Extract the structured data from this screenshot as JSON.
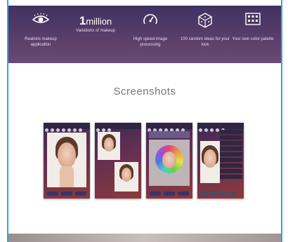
{
  "features": [
    {
      "icon": "eye-icon",
      "caption": "Realistic makeup application"
    },
    {
      "big_number": "1",
      "big_unit": "million",
      "caption": "Variations of makeup"
    },
    {
      "icon": "speedometer-icon",
      "caption": "High speed image processing"
    },
    {
      "icon": "dice-icon",
      "caption": "100 random ideas for your look"
    },
    {
      "icon": "palette-grid-icon",
      "caption": "Your own color palette"
    }
  ],
  "section_title": "Screenshots",
  "screenshots": [
    {
      "name": "screenshot-1"
    },
    {
      "name": "screenshot-2"
    },
    {
      "name": "screenshot-3"
    },
    {
      "name": "screenshot-4"
    }
  ]
}
